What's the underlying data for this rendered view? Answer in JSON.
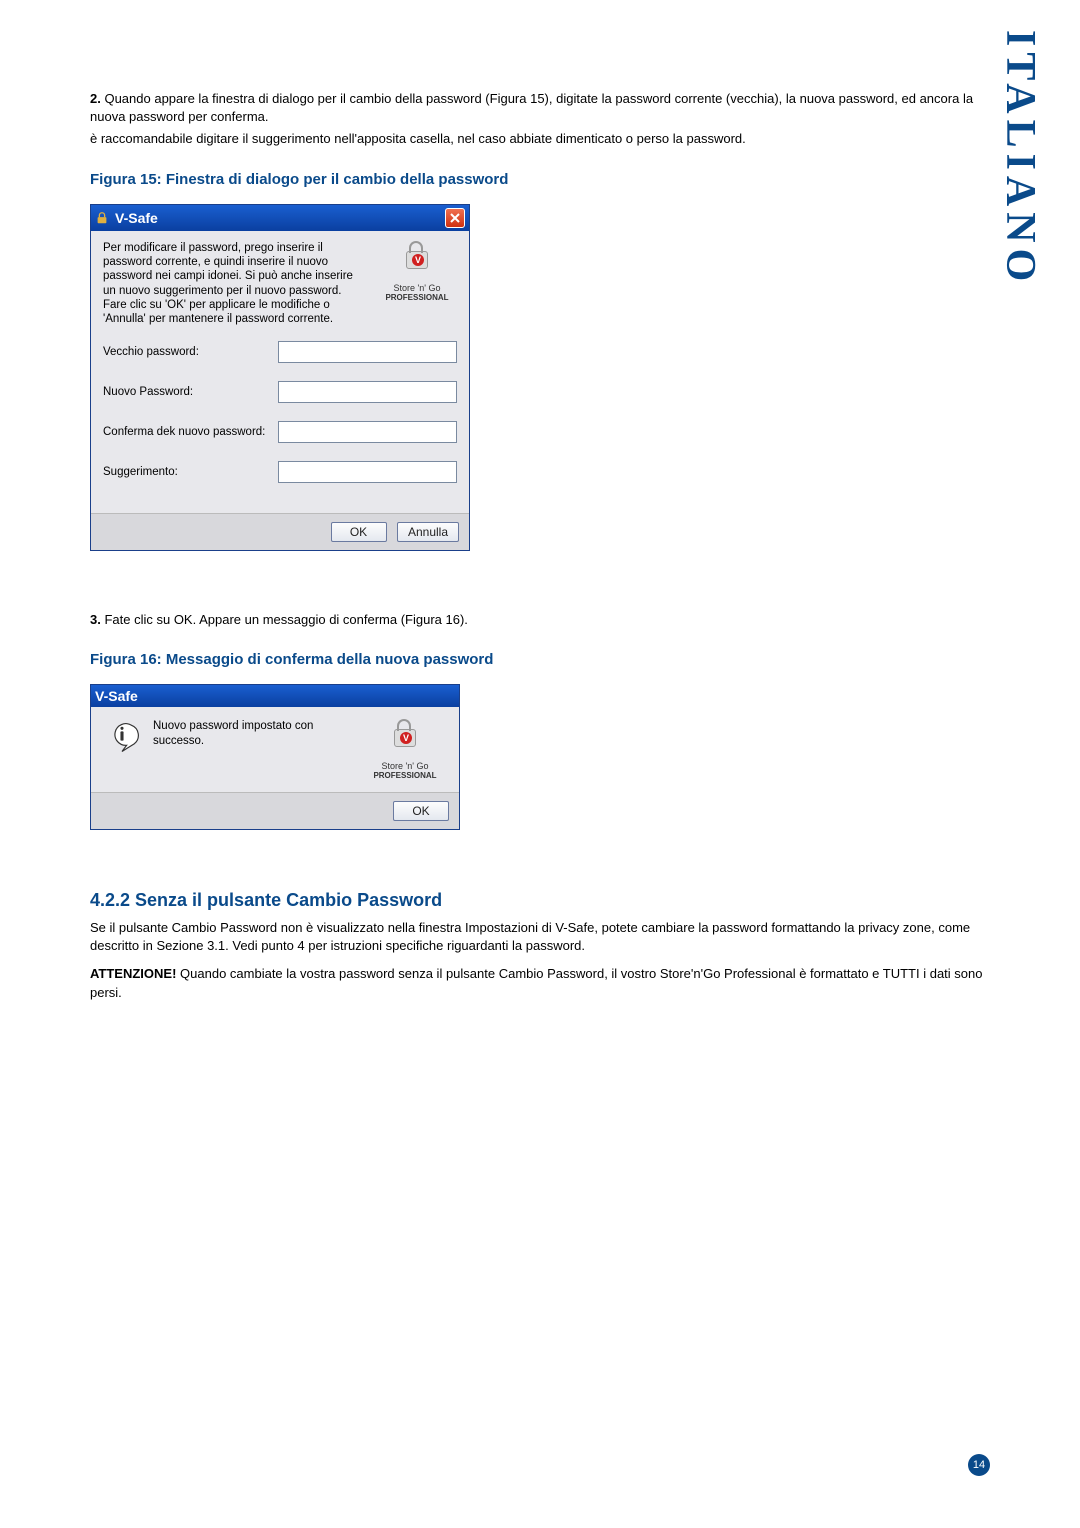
{
  "sideLabel": "ITALIANO",
  "step2": {
    "num": "2.",
    "text": "Quando appare la finestra di dialogo per il cambio della password (Figura 15), digitate la password corrente (vecchia), la nuova password, ed ancora la nuova password per conferma."
  },
  "hintLine": "è raccomandabile digitare il suggerimento nell'apposita casella, nel caso abbiate dimenticato o perso la password.",
  "fig15": {
    "caption": "Figura 15: Finestra di dialogo per il cambio della password",
    "title": "V-Safe",
    "instr": "Per modificare il password, prego inserire il password corrente, e quindi inserire il nuovo password nei campi idonei.  Si può anche inserire un nuovo suggerimento per il nuovo password.  Fare clic su 'OK' per applicare le modifiche o 'Annulla' per mantenere il password corrente.",
    "logo1": "Store 'n' Go",
    "logo2": "PROFESSIONAL",
    "fields": {
      "old": "Vecchio password:",
      "new": "Nuovo Password:",
      "confirm": "Conferma dek nuovo password:",
      "hint": "Suggerimento:"
    },
    "ok": "OK",
    "cancel": "Annulla"
  },
  "step3": {
    "num": "3.",
    "text": "Fate clic su OK. Appare un messaggio di conferma (Figura 16)."
  },
  "fig16": {
    "caption": "Figura 16: Messaggio di conferma della nuova password",
    "title": "V-Safe",
    "msg": "Nuovo password impostato con successo.",
    "logo1": "Store 'n' Go",
    "logo2": "PROFESSIONAL",
    "ok": "OK"
  },
  "section": {
    "heading": "4.2.2 Senza il pulsante Cambio Password",
    "p1": "Se il pulsante Cambio Password non è visualizzato nella finestra Impostazioni di V-Safe, potete cambiare la password formattando la privacy zone, come descritto in Sezione 3.1. Vedi punto 4 per istruzioni specifiche riguardanti la password.",
    "warnLabel": "ATTENZIONE!",
    "warnText": " Quando cambiate la vostra password senza il pulsante Cambio Password, il vostro Store'n'Go Professional è formattato e TUTTI i dati sono persi."
  },
  "pageNum": "14"
}
